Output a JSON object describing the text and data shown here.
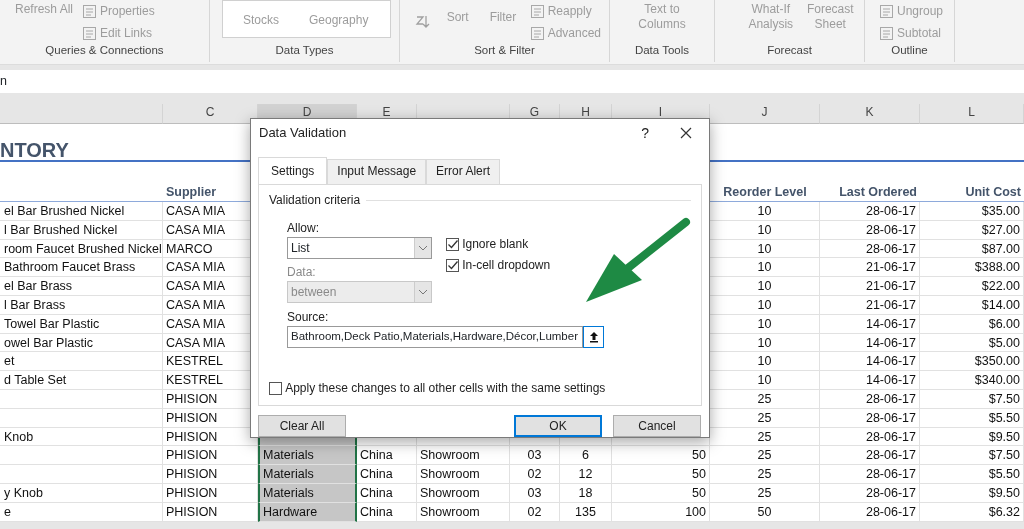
{
  "ribbon": {
    "groups": [
      {
        "label": "Queries & Connections",
        "commands": [
          {
            "kind": "large",
            "label": "Refresh All"
          },
          {
            "kind": "small",
            "label": "Properties"
          },
          {
            "kind": "small",
            "label": "Edit Links"
          }
        ]
      },
      {
        "label": "Data Types",
        "commands": [
          {
            "kind": "gallery",
            "label": "Stocks"
          },
          {
            "kind": "gallery",
            "label": "Geography"
          }
        ]
      },
      {
        "label": "Sort & Filter",
        "commands": [
          {
            "kind": "sorticon"
          },
          {
            "kind": "large",
            "label": "Sort"
          },
          {
            "kind": "large",
            "label": "Filter"
          },
          {
            "kind": "small",
            "label": "Reapply"
          },
          {
            "kind": "small",
            "label": "Advanced"
          }
        ]
      },
      {
        "label": "Data Tools",
        "commands": [
          {
            "kind": "large",
            "label": "Text to Columns"
          }
        ]
      },
      {
        "label": "Forecast",
        "commands": [
          {
            "kind": "large",
            "label": "What-If Analysis"
          },
          {
            "kind": "large",
            "label": "Forecast Sheet"
          }
        ]
      },
      {
        "label": "Outline",
        "commands": [
          {
            "kind": "small",
            "label": "Ungroup"
          },
          {
            "kind": "small",
            "label": "Subtotal"
          }
        ]
      }
    ]
  },
  "formula_bar": {
    "name_box": "n"
  },
  "sheet": {
    "columns": [
      {
        "selected": false
      },
      {
        "letter": "C",
        "heading": "Supplier",
        "selected": false
      },
      {
        "letter": "D",
        "selected": true
      },
      {
        "letter": "E",
        "selected": false
      },
      {
        "selected": false
      },
      {
        "letter": "G",
        "selected": false
      },
      {
        "letter": "H",
        "selected": false
      },
      {
        "letter": "I",
        "selected": false
      },
      {
        "letter": "J",
        "heading": "Reorder Level",
        "selected": false
      },
      {
        "letter": "K",
        "heading": "Last Ordered",
        "selected": false
      },
      {
        "letter": "L",
        "heading": "Unit Cost",
        "selected": false
      }
    ],
    "title": "NTORY",
    "rows": [
      {
        "column_1": "el Bar Brushed Nickel",
        "supplier": "CASA MIA",
        "reorder_level": "10",
        "last_ordered": "28-06-17",
        "unit_cost": "$35.00"
      },
      {
        "column_1": "l Bar Brushed Nickel",
        "supplier": "CASA MIA",
        "reorder_level": "10",
        "last_ordered": "28-06-17",
        "unit_cost": "$27.00"
      },
      {
        "column_1": "room Faucet Brushed Nickel",
        "supplier": "MARCO",
        "reorder_level": "10",
        "last_ordered": "28-06-17",
        "unit_cost": "$87.00"
      },
      {
        "column_1": "Bathroom Faucet Brass",
        "supplier": "CASA MIA",
        "reorder_level": "10",
        "last_ordered": "21-06-17",
        "unit_cost": "$388.00"
      },
      {
        "column_1": "el Bar Brass",
        "supplier": "CASA MIA",
        "reorder_level": "10",
        "last_ordered": "21-06-17",
        "unit_cost": "$22.00"
      },
      {
        "column_1": "l Bar Brass",
        "supplier": "CASA MIA",
        "reorder_level": "10",
        "last_ordered": "21-06-17",
        "unit_cost": "$14.00"
      },
      {
        "column_1": "Towel Bar Plastic",
        "supplier": "CASA MIA",
        "reorder_level": "10",
        "last_ordered": "14-06-17",
        "unit_cost": "$6.00"
      },
      {
        "column_1": "owel Bar Plastic",
        "supplier": "CASA MIA",
        "reorder_level": "10",
        "last_ordered": "14-06-17",
        "unit_cost": "$5.00"
      },
      {
        "column_1": "et",
        "supplier": "KESTREL",
        "reorder_level": "10",
        "last_ordered": "14-06-17",
        "unit_cost": "$350.00"
      },
      {
        "column_1": "d Table Set",
        "supplier": "KESTREL",
        "reorder_level": "10",
        "last_ordered": "14-06-17",
        "unit_cost": "$340.00"
      },
      {
        "supplier": "PHISION",
        "reorder_level": "25",
        "last_ordered": "28-06-17",
        "unit_cost": "$7.50"
      },
      {
        "supplier": "PHISION",
        "reorder_level": "25",
        "last_ordered": "28-06-17",
        "unit_cost": "$5.50"
      },
      {
        "column_1": "Knob",
        "supplier": "PHISION",
        "reorder_level": "25",
        "last_ordered": "28-06-17",
        "unit_cost": "$9.50"
      },
      {
        "supplier": "PHISION",
        "column_3": "Materials",
        "column_4": "China",
        "column_5": "Showroom",
        "column_6": "03",
        "column_7": "6",
        "column_8": "50",
        "reorder_level": "25",
        "last_ordered": "28-06-17",
        "unit_cost": "$7.50"
      },
      {
        "supplier": "PHISION",
        "column_3": "Materials",
        "column_4": "China",
        "column_5": "Showroom",
        "column_6": "02",
        "column_7": "12",
        "column_8": "50",
        "reorder_level": "25",
        "last_ordered": "28-06-17",
        "unit_cost": "$5.50"
      },
      {
        "column_1": "y Knob",
        "supplier": "PHISION",
        "column_3": "Materials",
        "column_4": "China",
        "column_5": "Showroom",
        "column_6": "03",
        "column_7": "18",
        "column_8": "50",
        "reorder_level": "25",
        "last_ordered": "28-06-17",
        "unit_cost": "$9.50"
      },
      {
        "column_1": "e",
        "supplier": "PHISION",
        "column_3": "Hardware",
        "column_4": "China",
        "column_5": "Showroom",
        "column_6": "02",
        "column_7": "135",
        "column_8": "100",
        "reorder_level": "50",
        "last_ordered": "28-06-17",
        "unit_cost": "$6.32"
      }
    ]
  },
  "dialog": {
    "title": "Data Validation",
    "help": "?",
    "tabs": [
      {
        "label": "Settings",
        "selected": true
      },
      {
        "label": "Input Message",
        "selected": false
      },
      {
        "label": "Error Alert",
        "selected": false
      }
    ],
    "group_label": "Validation criteria",
    "allow": {
      "label": "Allow:",
      "value": "List",
      "disabled": false
    },
    "data": {
      "label": "Data:",
      "value": "between",
      "disabled": true
    },
    "checkboxes": [
      {
        "label": "Ignore blank",
        "checked": true
      },
      {
        "label": "In-cell dropdown",
        "checked": true
      }
    ],
    "source": {
      "label": "Source:",
      "value": "Bathroom,Deck Patio,Materials,Hardware,Décor,Lumber"
    },
    "apply_all": {
      "label": "Apply these changes to all other cells with the same settings",
      "checked": false
    },
    "buttons": [
      {
        "label": "Clear All",
        "default": false
      },
      {
        "label": "OK",
        "default": true
      },
      {
        "label": "Cancel",
        "default": false
      }
    ]
  }
}
